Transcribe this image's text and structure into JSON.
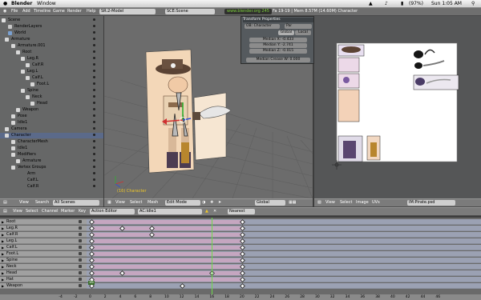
{
  "mac_menu": {
    "apple": "",
    "app": "Blender",
    "window": "Window",
    "status": "(97%)",
    "clock": "Sun 1:05 AM"
  },
  "blender_header": {
    "menus": [
      "File",
      "Add",
      "Timeline",
      "Game",
      "Render",
      "Help"
    ],
    "screen": "SR:2-Model",
    "scene": "SCE:Scene",
    "url": "www.blender.org 245",
    "stats": "Fa 19-19 | Mem 8.57M (14.60M) Character"
  },
  "outliner": {
    "rows": [
      {
        "label": "Scene",
        "indent": 2,
        "icon": "scene-icon",
        "color": "#e0e0e0"
      },
      {
        "label": "RenderLayers",
        "indent": 10,
        "icon": "renderlayers-icon",
        "color": "#c8c8c8"
      },
      {
        "label": "World",
        "indent": 10,
        "icon": "world-icon",
        "color": "#7aa0d0"
      },
      {
        "label": "Armature",
        "indent": 6,
        "icon": "armature-icon",
        "color": "#d8d8d8"
      },
      {
        "label": "Armature.001",
        "indent": 14,
        "icon": "armature-icon",
        "color": "#d8d8d8"
      },
      {
        "label": "Root",
        "indent": 20,
        "icon": "bone-icon",
        "color": "#d8d8d8"
      },
      {
        "label": "Leg.R",
        "indent": 26,
        "icon": "bone-icon",
        "color": "#d8d8d8"
      },
      {
        "label": "Calf.R",
        "indent": 32,
        "icon": "bone-icon",
        "color": "#d8d8d8"
      },
      {
        "label": "Leg.L",
        "indent": 26,
        "icon": "bone-icon",
        "color": "#d8d8d8"
      },
      {
        "label": "Calf.L",
        "indent": 32,
        "icon": "bone-icon",
        "color": "#d8d8d8"
      },
      {
        "label": "Foot.L",
        "indent": 38,
        "icon": "bone-icon",
        "color": "#d8d8d8"
      },
      {
        "label": "Spine",
        "indent": 26,
        "icon": "bone-icon",
        "color": "#d8d8d8"
      },
      {
        "label": "Neck",
        "indent": 32,
        "icon": "bone-icon",
        "color": "#d8d8d8"
      },
      {
        "label": "Head",
        "indent": 38,
        "icon": "bone-icon",
        "color": "#d8d8d8"
      },
      {
        "label": "Weapon",
        "indent": 20,
        "icon": "bone-icon",
        "color": "#d8d8d8"
      },
      {
        "label": "Pose",
        "indent": 14,
        "icon": "pose-icon",
        "color": "#d8d8d8"
      },
      {
        "label": "Idle1",
        "indent": 14,
        "icon": "action-icon",
        "color": "#d8d8d8"
      },
      {
        "label": "Camera",
        "indent": 6,
        "icon": "camera-icon",
        "color": "#d8d8d8"
      },
      {
        "label": "Character",
        "indent": 6,
        "icon": "object-icon",
        "color": "#d8d8d8",
        "selected": true
      },
      {
        "label": "CharacterMesh",
        "indent": 14,
        "icon": "mesh-icon",
        "color": "#d8d8d8"
      },
      {
        "label": "Idle1",
        "indent": 14,
        "icon": "action-icon",
        "color": "#d8d8d8"
      },
      {
        "label": "Modifiers",
        "indent": 14,
        "icon": "modifier-icon",
        "color": "#d8d8d8"
      },
      {
        "label": "Armature",
        "indent": 20,
        "icon": "modifier-icon",
        "color": "#d8d8d8"
      },
      {
        "label": "Vertex Groups",
        "indent": 14,
        "icon": "vgroup-icon",
        "color": "#d8d8d8"
      },
      {
        "label": "Arm",
        "indent": 26,
        "icon": "",
        "color": ""
      },
      {
        "label": "Calf.L",
        "indent": 26,
        "icon": "",
        "color": ""
      },
      {
        "label": "Calf.R",
        "indent": 26,
        "icon": "",
        "color": ""
      }
    ]
  },
  "transform_properties": {
    "title": "Transform Properties",
    "ob_label": "OB: Character",
    "par_label": "Par",
    "global": "Global",
    "local": "Local",
    "median_x": "Median X: -0.433",
    "median_y": "Median Y: -2.741",
    "median_z": "Median Z: -0.015",
    "crease": "Median Crease W: 0.000"
  },
  "view3d": {
    "object_label": "(16) Character"
  },
  "outliner_header": {
    "view": "View",
    "search": "Search",
    "scope": "All Scenes"
  },
  "view3d_header": {
    "view": "View",
    "select": "Select",
    "mesh": "Mesh",
    "mode": "Edit Mode",
    "orient": "Global"
  },
  "image_header": {
    "view": "View",
    "select": "Select",
    "image": "Image",
    "uvs": "UVs",
    "image_name": "IM:Pirate.psd"
  },
  "action_header": {
    "view": "View",
    "select": "Select",
    "channel": "Channel",
    "marker": "Marker",
    "key": "Key",
    "mode": "Action Editor",
    "action": "AC:Idle1",
    "snap": "Nearest"
  },
  "action_channels": [
    {
      "name": "Root",
      "bars": [
        [
          0,
          20
        ]
      ],
      "keys": [
        0,
        20
      ]
    },
    {
      "name": "Leg.R",
      "bars": [
        [
          0,
          20
        ]
      ],
      "keys": [
        0,
        4,
        8,
        20
      ]
    },
    {
      "name": "Calf.R",
      "bars": [
        [
          0,
          20
        ]
      ],
      "keys": [
        0,
        8,
        20
      ]
    },
    {
      "name": "Leg.L",
      "bars": [
        [
          0,
          20
        ]
      ],
      "keys": [
        0,
        20
      ]
    },
    {
      "name": "Calf.L",
      "bars": [
        [
          0,
          20
        ]
      ],
      "keys": [
        0,
        20
      ]
    },
    {
      "name": "Foot.L",
      "bars": [
        [
          0,
          20
        ]
      ],
      "keys": [
        0,
        20
      ]
    },
    {
      "name": "Spine",
      "bars": [
        [
          0,
          20
        ]
      ],
      "keys": [
        0,
        20
      ]
    },
    {
      "name": "Neck",
      "bars": [
        [
          0,
          20
        ]
      ],
      "keys": [
        0,
        20
      ]
    },
    {
      "name": "Head",
      "bars": [
        [
          0,
          20
        ]
      ],
      "keys": [
        0,
        4,
        16,
        20
      ]
    },
    {
      "name": "Hat",
      "bars": [
        [
          0,
          20
        ]
      ],
      "keys": [
        0,
        20
      ]
    },
    {
      "name": "Weapon",
      "bars": [],
      "keys": [
        0,
        12,
        20
      ]
    }
  ],
  "timeline": {
    "current_frame": "16",
    "ticks": [
      "-4",
      "-2",
      "0",
      "2",
      "4",
      "6",
      "8",
      "10",
      "12",
      "14",
      "16",
      "18",
      "20",
      "22",
      "24",
      "26",
      "28",
      "30",
      "32",
      "34",
      "36",
      "38",
      "40",
      "42",
      "44",
      "46"
    ]
  },
  "colors": {
    "selection": "#5b6a8a",
    "action_bar": "#c5a6c0",
    "playhead": "#6fd84a",
    "url_green": "#7cd03a"
  }
}
